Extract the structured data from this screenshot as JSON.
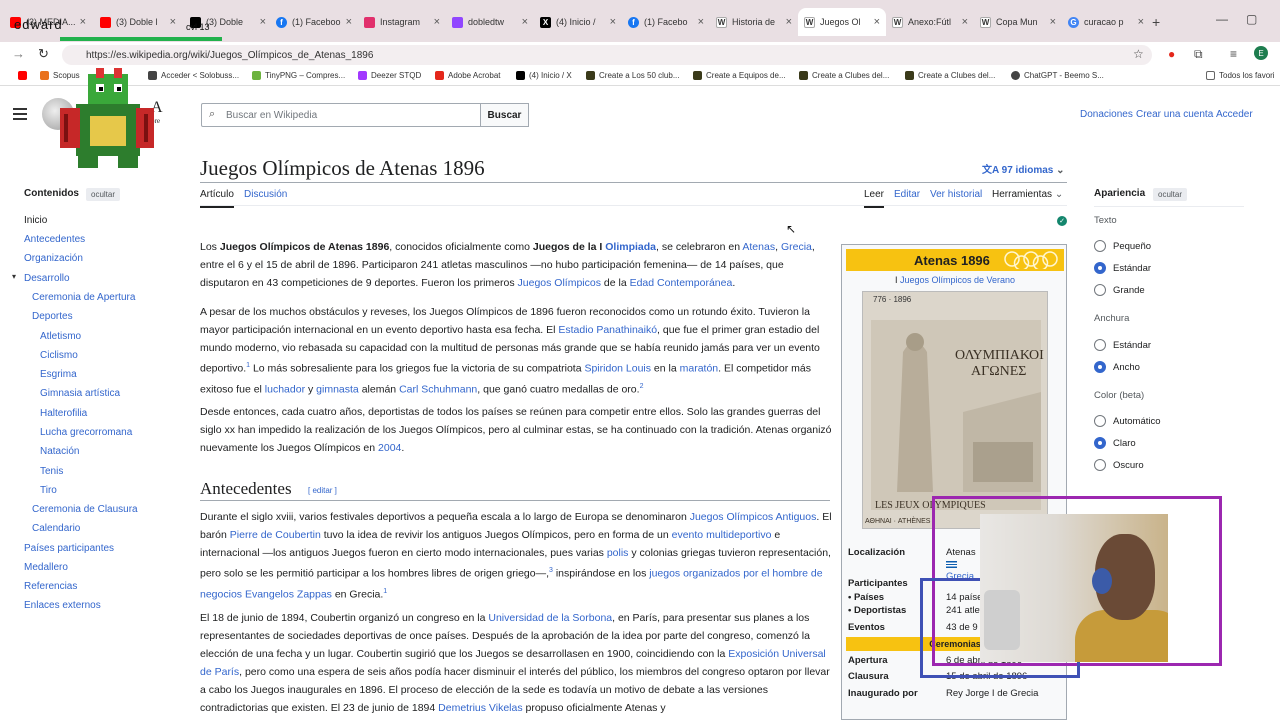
{
  "browser": {
    "tabs": [
      {
        "label": "(3) MEDIA...",
        "color": "#ff0000"
      },
      {
        "label": "(3) Doble l",
        "color": "#ff0000"
      },
      {
        "label": "(3) Doble",
        "color": "#000000"
      },
      {
        "label": "(1) Faceboo",
        "color": "#1877f2"
      },
      {
        "label": "Instagram",
        "color": "#e1306c"
      },
      {
        "label": "dobledtw",
        "color": "#9146ff"
      },
      {
        "label": "(4) Inicio /",
        "color": "#000000"
      },
      {
        "label": "(1) Facebo",
        "color": "#1877f2"
      },
      {
        "label": "Historia de",
        "color": "#555555"
      },
      {
        "label": "Juegos Ol",
        "color": "#555555"
      },
      {
        "label": "Anexo:Fútl",
        "color": "#555555"
      },
      {
        "label": "Copa Mun",
        "color": "#555555"
      },
      {
        "label": "curacao p",
        "color": "#4285f4"
      }
    ],
    "url": "https://es.wikipedia.org/wiki/Juegos_Olímpicos_de_Atenas_1896",
    "bookmarks": [
      {
        "label": "Scopus",
        "color": "#e9711c"
      },
      {
        "label": "Acceder < Solobuss...",
        "color": "#444444"
      },
      {
        "label": "TinyPNG – Compres...",
        "color": "#6db33f"
      },
      {
        "label": "Deezer STQD",
        "color": "#a238ff"
      },
      {
        "label": "Adobe Acrobat",
        "color": "#e4271b"
      },
      {
        "label": "(4) Inicio / X",
        "color": "#000000"
      },
      {
        "label": "Create a Los 50 club...",
        "color": "#3a3a1a"
      },
      {
        "label": "Create a Equipos de...",
        "color": "#3a3a1a"
      },
      {
        "label": "Create a Clubes del...",
        "color": "#3a3a1a"
      },
      {
        "label": "Create a Clubes del...",
        "color": "#3a3a1a"
      },
      {
        "label": "ChatGPT - Beemo S...",
        "color": "#444444"
      }
    ],
    "bookmark_folder": "Todos los favori"
  },
  "overlay": {
    "name": "edward",
    "counter": "cvl 13"
  },
  "header": {
    "logo_letter": "A",
    "logo_sub": "bre",
    "search_placeholder": "Buscar en Wikipedia",
    "search_button": "Buscar",
    "links": [
      "Donaciones",
      "Crear una cuenta",
      "Acceder"
    ]
  },
  "toc": {
    "heading": "Contenidos",
    "hide": "ocultar",
    "items": [
      {
        "label": "Inicio",
        "level": 0
      },
      {
        "label": "Antecedentes",
        "level": 0
      },
      {
        "label": "Organización",
        "level": 0
      },
      {
        "label": "Desarrollo",
        "level": 0
      },
      {
        "label": "Ceremonia de Apertura",
        "level": 1
      },
      {
        "label": "Deportes",
        "level": 1
      },
      {
        "label": "Atletismo",
        "level": 2
      },
      {
        "label": "Ciclismo",
        "level": 2
      },
      {
        "label": "Esgrima",
        "level": 2
      },
      {
        "label": "Gimnasia artística",
        "level": 2
      },
      {
        "label": "Halterofilia",
        "level": 2
      },
      {
        "label": "Lucha grecorromana",
        "level": 2
      },
      {
        "label": "Natación",
        "level": 2
      },
      {
        "label": "Tenis",
        "level": 2
      },
      {
        "label": "Tiro",
        "level": 2
      },
      {
        "label": "Ceremonia de Clausura",
        "level": 1
      },
      {
        "label": "Calendario",
        "level": 1
      },
      {
        "label": "Países participantes",
        "level": 0
      },
      {
        "label": "Medallero",
        "level": 0
      },
      {
        "label": "Referencias",
        "level": 0
      },
      {
        "label": "Enlaces externos",
        "level": 0
      }
    ]
  },
  "article": {
    "title": "Juegos Olímpicos de Atenas 1896",
    "languages": "97 idiomas",
    "tabs_left": [
      "Artículo",
      "Discusión"
    ],
    "tabs_right": [
      "Leer",
      "Editar",
      "Ver historial",
      "Herramientas"
    ],
    "p1": {
      "a": "Los ",
      "b": "Juegos Olímpicos de Atenas 1896",
      "c": ", conocidos oficialmente como ",
      "d": "Juegos de la I ",
      "e": "Olimpiada",
      "f": ", se celebraron en ",
      "g": "Atenas",
      "h": ", ",
      "i": "Grecia",
      "j": ", entre el 6 y el 15 de abril de 1896. Participaron 241 atletas masculinos —no hubo participación femenina— de 14 países, que disputaron en 43 competiciones de 9 deportes. Fueron los primeros ",
      "k": "Juegos Olímpicos",
      "l": " de la ",
      "m": "Edad Contemporánea",
      "n": "."
    },
    "p2": {
      "a": "A pesar de los muchos obstáculos y reveses, los Juegos Olímpicos de 1896 fueron reconocidos como un rotundo éxito. Tuvieron la mayor participación internacional en un evento deportivo hasta esa fecha. El ",
      "b": "Estadio Panathinaikó",
      "c": ", que fue el primer gran estadio del mundo moderno, vio rebasada su capacidad con la multitud de personas más grande que se había reunido jamás para ver un evento deportivo.",
      "s1": "1",
      "d": " Lo más sobresaliente para los griegos fue la victoria de su compatriota ",
      "e": "Spiridon Louis",
      "f": " en la ",
      "g": "maratón",
      "h": ". El competidor más exitoso fue el ",
      "i": "luchador",
      "j": " y ",
      "k": "gimnasta",
      "l": " alemán ",
      "m": "Carl Schuhmann",
      "n": ", que ganó cuatro medallas de oro.",
      "s2": "2"
    },
    "p3": {
      "a": "Desde entonces, cada cuatro años, deportistas de todos los países se reúnen para competir entre ellos. Solo las grandes guerras del siglo xx han impedido la realización de los Juegos Olímpicos, pero al culminar estas, se ha continuado con la tradición. Atenas organizó nuevamente los Juegos Olímpicos en ",
      "b": "2004",
      "c": "."
    },
    "h2": "Antecedentes",
    "h2_edit": "[ editar ]",
    "p4": {
      "a": "Durante el siglo xviii, varios festivales deportivos a pequeña escala a lo largo de Europa se denominaron ",
      "b": "Juegos Olímpicos Antiguos",
      "c": ". El barón ",
      "d": "Pierre de Coubertin",
      "e": " tuvo la idea de revivir los antiguos Juegos Olímpicos, pero en forma de un ",
      "f": "evento multideportivo",
      "g": " e internacional —los antiguos Juegos fueron en cierto modo internacionales, pues varias ",
      "h": "polis",
      "i": " y colonias griegas tuvieron representación, pero solo se les permitió participar a los hombres libres de origen griego—,",
      "s1": "3",
      "j": " inspirándose en los ",
      "k": "juegos organizados por el hombre de negocios Evangelos Zappas",
      "l": " en Grecia.",
      "s2": "1"
    },
    "p5": {
      "a": "El 18 de junio de 1894, Coubertin organizó un congreso en la ",
      "b": "Universidad de la Sorbona",
      "c": ", en París, para presentar sus planes a los representantes de sociedades deportivas de once países. Después de la aprobación de la idea por parte del congreso, comenzó la elección de una fecha y un lugar. Coubertin sugirió que los Juegos se desarrollasen en 1900, coincidiendo con la ",
      "d": "Exposición Universal de París",
      "e": ", pero como una espera de seis años podía hacer disminuir el interés del público, los miembros del congreso optaron por llevar a cabo los Juegos inaugurales en 1896. El proceso de elección de la sede es todavía un motivo de debate a las versiones contradictorias que existen. El 23 de junio de 1894 ",
      "f": "Demetrius Vikelas",
      "g": " propuso oficialmente Atenas y"
    }
  },
  "infobox": {
    "title": "Atenas 1896",
    "subtitle_prefix": "I ",
    "subtitle_link": "Juegos Olímpicos de Verano",
    "poster_top": "776 · 1896",
    "poster_text_1": "ΟΛΥΜΠΙΑΚΟΙ",
    "poster_text_2": "ΑΓΩΝΕΣ",
    "poster_bottom": "LES JEUX OLYMPIQUES",
    "poster_foot": "ΑΘΗΝΑΙ · ATHÈNES",
    "rows": {
      "localizacion": {
        "label": "Localización",
        "value": "Atenas",
        "value2": "Grecia"
      },
      "participantes": {
        "label": "Participantes"
      },
      "paises": {
        "label": "• Países",
        "value": "14 países"
      },
      "deportistas": {
        "label": "• Deportistas",
        "value": "241 atletas"
      },
      "eventos": {
        "label": "Eventos",
        "value": "43 de 9"
      },
      "ceremonias": "Ceremonias",
      "apertura": {
        "label": "Apertura",
        "value": "6 de abril de 1896"
      },
      "clausura": {
        "label": "Clausura",
        "value": "15 de abril de 1896"
      },
      "inaugurado": {
        "label": "Inaugurado por",
        "value": "Rey Jorge I de Grecia"
      }
    }
  },
  "appearance": {
    "heading": "Apariencia",
    "hide": "ocultar",
    "texto": {
      "label": "Texto",
      "options": [
        "Pequeño",
        "Estándar",
        "Grande"
      ],
      "selected": 1
    },
    "anchura": {
      "label": "Anchura",
      "options": [
        "Estándar",
        "Ancho"
      ],
      "selected": 1
    },
    "color": {
      "label": "Color (beta)",
      "options": [
        "Automático",
        "Claro",
        "Oscuro"
      ],
      "selected": 1
    }
  },
  "colors": {
    "link": "#3366cc",
    "gold": "#f7c211",
    "chrome": "#e9dfe3"
  }
}
